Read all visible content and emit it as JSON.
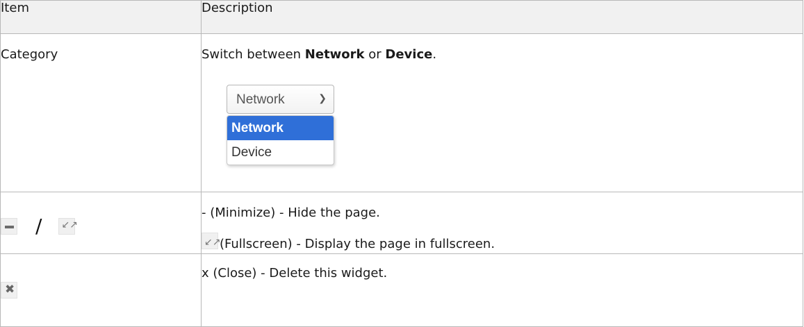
{
  "table": {
    "headers": [
      "Item",
      "Description"
    ],
    "rows": {
      "category": {
        "item": "Category",
        "desc_prefix": "Switch between ",
        "desc_kw1": "Network",
        "desc_mid": " or ",
        "desc_kw2": "Device",
        "desc_suffix": ".",
        "dropdown": {
          "selected_value": "Network",
          "options": [
            "Network",
            "Device"
          ]
        }
      },
      "minimize": {
        "separator": "/",
        "line1": "- (Minimize) - Hide the page.",
        "line2": "(Fullscreen) - Display the page in fullscreen."
      },
      "close": {
        "line1": "x (Close) - Delete this widget."
      }
    }
  },
  "icons": {
    "minimize": "minus-icon",
    "fullscreen": "expand-arrows-icon",
    "close": "x-icon"
  },
  "colors": {
    "header_bg": "#f1f1f1",
    "border": "#b8b8b8",
    "dropdown_highlight": "#2f6fd8"
  }
}
